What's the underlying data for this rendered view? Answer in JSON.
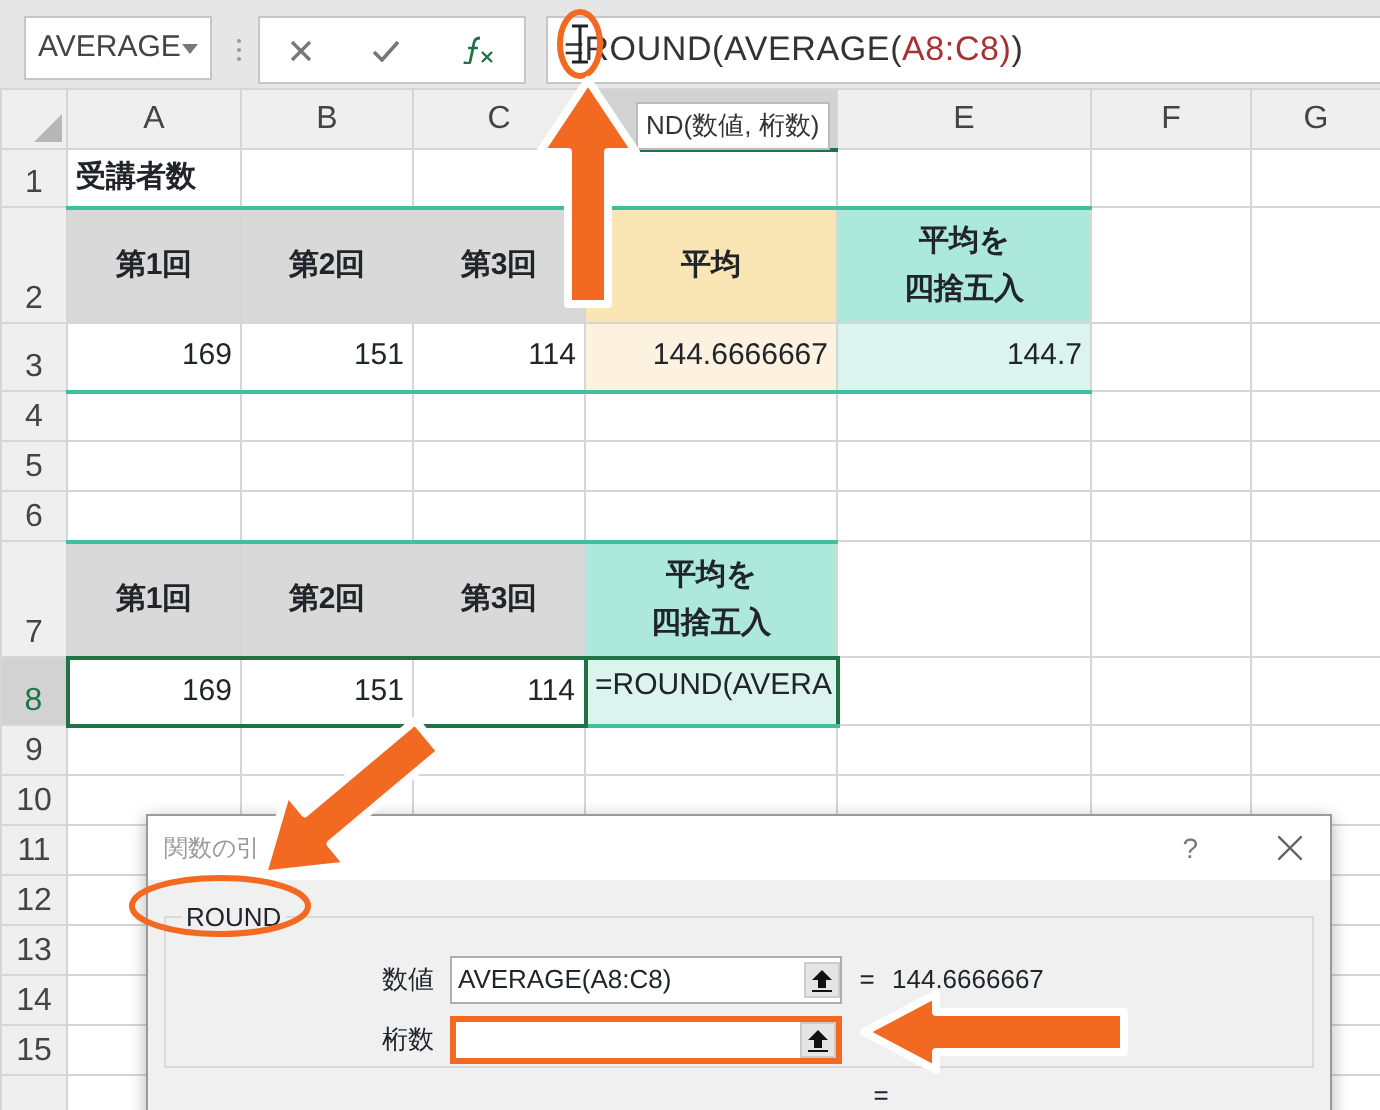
{
  "name_box": {
    "value": "AVERAGE"
  },
  "formula_bar": {
    "segments": [
      {
        "text": "=ROUND(",
        "color": "#333333"
      },
      {
        "text": "AVERAGE(",
        "color": "#333333"
      },
      {
        "text": "A8:C8",
        "color": "#a83232"
      },
      {
        "text": ")",
        "color": "#a83232"
      },
      {
        "text": ")",
        "color": "#333333"
      }
    ]
  },
  "tooltip": {
    "text": "ND(数値, 桁数)"
  },
  "columns": [
    {
      "label": "A",
      "selected": false
    },
    {
      "label": "B",
      "selected": false
    },
    {
      "label": "C",
      "selected": false
    },
    {
      "selected": true
    },
    {
      "label": "E",
      "selected": false
    },
    {
      "label": "F",
      "selected": false
    },
    {
      "label": "G",
      "selected": false
    }
  ],
  "rows": [
    {
      "num": "1",
      "kind": "title",
      "selected": false,
      "cells": [
        {
          "text": "受講者数",
          "kind": "title"
        }
      ]
    },
    {
      "num": "2",
      "kind": "header",
      "selected": false,
      "rule_top": true,
      "cells": [
        {
          "text": "第1回",
          "kind": "label",
          "color": "#d9d9d9"
        },
        {
          "text": "第2回",
          "kind": "label",
          "color": "#d9d9d9"
        },
        {
          "text": "第3回",
          "kind": "label",
          "color": "#d9d9d9"
        },
        {
          "text": "平均",
          "kind": "label",
          "color": "#fae5b4"
        },
        {
          "lines": [
            "平均を",
            "四捨五入"
          ],
          "kind": "label",
          "color": "#ace8dc"
        }
      ]
    },
    {
      "num": "3",
      "kind": "data",
      "selected": false,
      "rule_bottom": true,
      "cells": [
        {
          "text": "169",
          "kind": "number"
        },
        {
          "text": "151",
          "kind": "number"
        },
        {
          "text": "114",
          "kind": "number"
        },
        {
          "text": "144.6666667",
          "kind": "number",
          "color": "#fdf2e0"
        },
        {
          "text": "144.7",
          "kind": "number",
          "color": "#dcf4ee"
        }
      ]
    },
    {
      "num": "4",
      "kind": "empty",
      "selected": false,
      "cells": []
    },
    {
      "num": "5",
      "kind": "empty",
      "selected": false,
      "cells": []
    },
    {
      "num": "6",
      "kind": "empty",
      "selected": false,
      "cells": []
    },
    {
      "num": "7",
      "kind": "header",
      "selected": false,
      "rule_top": true,
      "cells": [
        {
          "text": "第1回",
          "kind": "label",
          "color": "#d9d9d9"
        },
        {
          "text": "第2回",
          "kind": "label",
          "color": "#d9d9d9"
        },
        {
          "text": "第3回",
          "kind": "label",
          "color": "#d9d9d9"
        },
        {
          "lines": [
            "平均を",
            "四捨五入"
          ],
          "kind": "label",
          "color": "#ace8dc"
        }
      ]
    },
    {
      "num": "8",
      "kind": "data",
      "selected": true,
      "rule_bottom": true,
      "cells": [
        {
          "text": "169",
          "kind": "number",
          "referenced": true
        },
        {
          "text": "151",
          "kind": "number",
          "referenced": true
        },
        {
          "text": "114",
          "kind": "number",
          "referenced": true
        },
        {
          "text": "=ROUND(AVERA",
          "kind": "formula",
          "color": "#dcf4ee",
          "selected": true
        }
      ]
    },
    {
      "num": "9",
      "kind": "empty",
      "selected": false,
      "cells": []
    },
    {
      "num": "10",
      "kind": "empty",
      "selected": false,
      "cells": []
    },
    {
      "num": "11",
      "kind": "empty",
      "selected": false,
      "cells": []
    },
    {
      "num": "12",
      "kind": "empty",
      "selected": false,
      "cells": []
    },
    {
      "num": "13",
      "kind": "empty",
      "selected": false,
      "cells": []
    },
    {
      "num": "14",
      "kind": "empty",
      "selected": false,
      "cells": []
    },
    {
      "num": "15",
      "kind": "empty",
      "selected": false,
      "cells": []
    }
  ],
  "dialog": {
    "title": "関数の引",
    "help": "?",
    "group": "ROUND",
    "arguments": [
      {
        "label": "数値",
        "value": "AVERAGE(A8:C8)",
        "equals": "=",
        "result": "144.6666667",
        "highlighted": false
      },
      {
        "label": "桁数",
        "highlighted": true
      }
    ],
    "result_equals": "="
  }
}
